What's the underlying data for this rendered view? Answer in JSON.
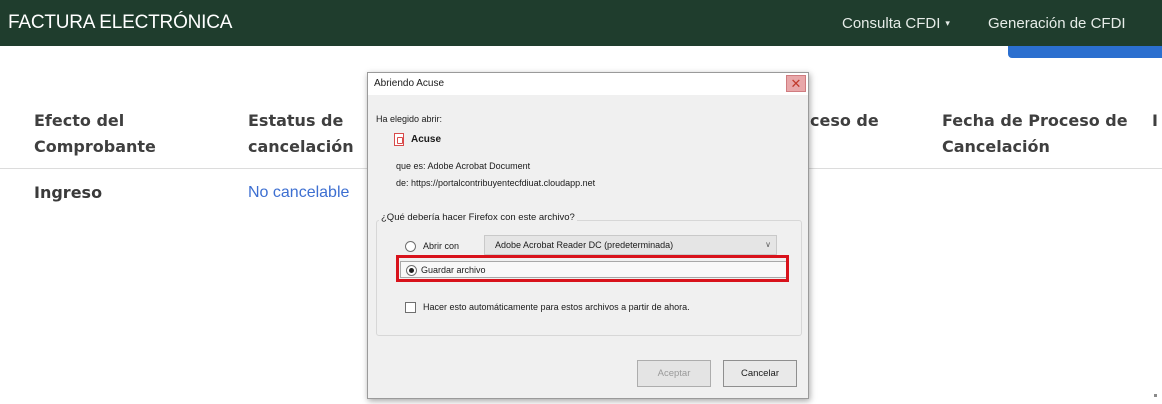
{
  "navbar": {
    "brand": "FACTURA ELECTRÓNICA",
    "consulta": "Consulta CFDI",
    "consulta_caret": "▾",
    "generacion": "Generación de CFDI",
    "bg_color": "#1f3d2d"
  },
  "table": {
    "headers": {
      "efecto": "Efecto del Comprobante",
      "estatus": "Estatus de cancelación",
      "proceso": "ceso de",
      "fecha": "Fecha de Proceso de Cancelación",
      "extra": "I"
    },
    "row": {
      "efecto": "Ingreso",
      "estatus": "No cancelable"
    },
    "link_color": "#3d6fd1"
  },
  "dialog": {
    "title": "Abriendo Acuse",
    "close_glyph": "✕",
    "chosen_label": "Ha elegido abrir:",
    "file_name": "Acuse",
    "type_line": "que es:  Adobe Acrobat Document",
    "from_line": "de:  https://portalcontribuyentecfdiuat.cloudapp.net",
    "question": "¿Qué debería hacer Firefox con este archivo?",
    "open_with_label": "Abrir con",
    "open_with_value": "Adobe Acrobat Reader DC  (predeterminada)",
    "open_with_selected": false,
    "save_label": "Guardar archivo",
    "save_selected": true,
    "auto_label": "Hacer esto automáticamente para estos archivos a partir de ahora.",
    "auto_checked": false,
    "accept_label": "Aceptar",
    "cancel_label": "Cancelar",
    "highlight_color": "#d8121b"
  }
}
